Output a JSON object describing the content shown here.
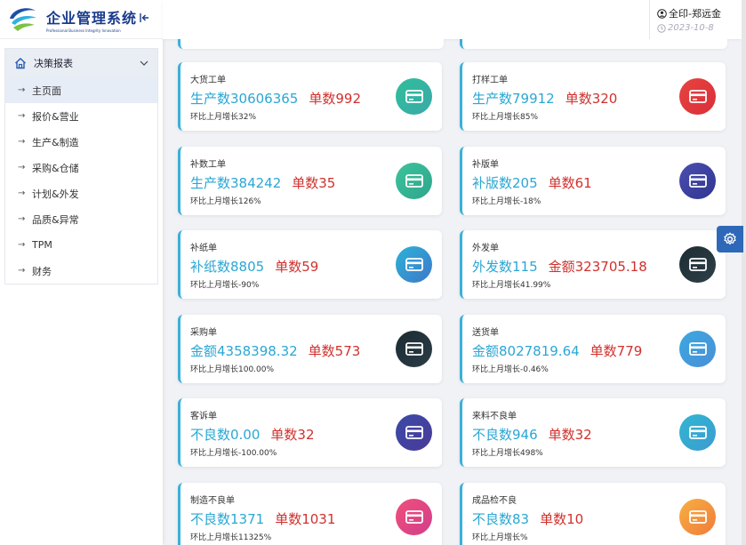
{
  "app": {
    "title": "企业管理系统",
    "subtitle": "Professional Business Integrity Innovation"
  },
  "sidebar": {
    "group_label": "决策报表",
    "items": [
      {
        "label": "主页面",
        "active": true
      },
      {
        "label": "报价&营业"
      },
      {
        "label": "生产&制造"
      },
      {
        "label": "采购&仓储"
      },
      {
        "label": "计划&外发"
      },
      {
        "label": "品质&异常"
      },
      {
        "label": "TPM"
      },
      {
        "label": "财务"
      }
    ]
  },
  "header": {
    "user": "全印-郑远金",
    "date": "2023-10-8"
  },
  "cards": [
    {
      "title": "大货工单",
      "main_a": "生产数30606365",
      "main_b": "单数992",
      "sub": "环比上月增长32%",
      "icon_color_a": "#2fbf9a",
      "icon_color_b": "#3aa9a8"
    },
    {
      "title": "打样工单",
      "main_a": "生产数79912",
      "main_b": "单数320",
      "sub": "环比上月增长85%",
      "icon_color_a": "#e8433f",
      "icon_color_b": "#d92f3a"
    },
    {
      "title": "补数工单",
      "main_a": "生产数384242",
      "main_b": "单数35",
      "sub": "环比上月增长126%",
      "icon_color_a": "#3cc39b",
      "icon_color_b": "#2fa58c"
    },
    {
      "title": "补版单",
      "main_a": "补版数205",
      "main_b": "单数61",
      "sub": "环比上月增长-18%",
      "icon_color_a": "#4b4fb0",
      "icon_color_b": "#2f3590"
    },
    {
      "title": "补纸单",
      "main_a": "补纸数8805",
      "main_b": "单数59",
      "sub": "环比上月增长-90%",
      "icon_color_a": "#2bb3d8",
      "icon_color_b": "#3f77c9"
    },
    {
      "title": "外发单",
      "main_a": "外发数115",
      "main_b": "金额323705.18",
      "sub": "环比上月增长41.99%",
      "icon_color_a": "#1e2d33",
      "icon_color_b": "#2d3f48"
    },
    {
      "title": "采购单",
      "main_a": "金额4358398.32",
      "main_b": "单数573",
      "sub": "环比上月增长100.00%",
      "icon_color_a": "#1c2b32",
      "icon_color_b": "#2c3d46"
    },
    {
      "title": "送货单",
      "main_a": "金额8027819.64",
      "main_b": "单数779",
      "sub": "环比上月增长-0.46%",
      "icon_color_a": "#3aa8e0",
      "icon_color_b": "#4b8fd6"
    },
    {
      "title": "客诉单",
      "main_a": "不良数0.00",
      "main_b": "单数32",
      "sub": "环比上月增长-100.00%",
      "icon_color_a": "#3b4aa8",
      "icon_color_b": "#4a3a98"
    },
    {
      "title": "来料不良单",
      "main_a": "不良数946",
      "main_b": "单数32",
      "sub": "环比上月增长498%",
      "icon_color_a": "#31b6d2",
      "icon_color_b": "#3c9bd0"
    },
    {
      "title": "制造不良单",
      "main_a": "不良数1371",
      "main_b": "单数1031",
      "sub": "环比上月增长11325%",
      "icon_color_a": "#f0507a",
      "icon_color_b": "#d23d8c"
    },
    {
      "title": "成品检不良",
      "main_a": "不良数83",
      "main_b": "单数10",
      "sub": "环比上月增长%",
      "icon_color_a": "#f7b043",
      "icon_color_b": "#f07b3a"
    }
  ]
}
